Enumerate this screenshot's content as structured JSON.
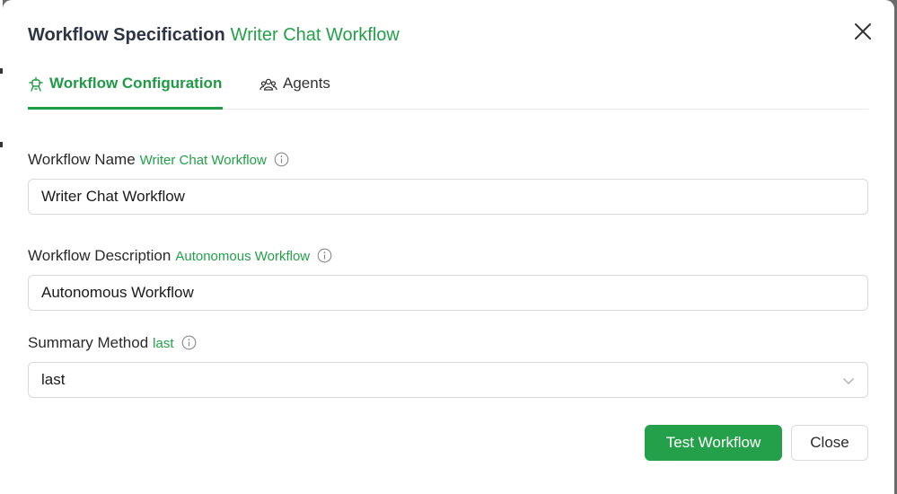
{
  "modal": {
    "title": "Workflow Specification",
    "subtitle": "Writer Chat Workflow",
    "close_icon": "close-icon"
  },
  "tabs": [
    {
      "label": "Workflow Configuration",
      "icon": "workflow-icon",
      "active": true
    },
    {
      "label": "Agents",
      "icon": "users-icon",
      "active": false
    }
  ],
  "fields": {
    "name": {
      "label": "Workflow Name",
      "hint": "Writer Chat Workflow",
      "value": "Writer Chat Workflow"
    },
    "description": {
      "label": "Workflow Description",
      "hint": "Autonomous Workflow",
      "value": "Autonomous Workflow"
    },
    "summary": {
      "label": "Summary Method",
      "hint": "last",
      "value": "last"
    }
  },
  "buttons": {
    "test": "Test Workflow",
    "close": "Close"
  },
  "colors": {
    "accent": "#23a049",
    "title": "#2d3443"
  }
}
